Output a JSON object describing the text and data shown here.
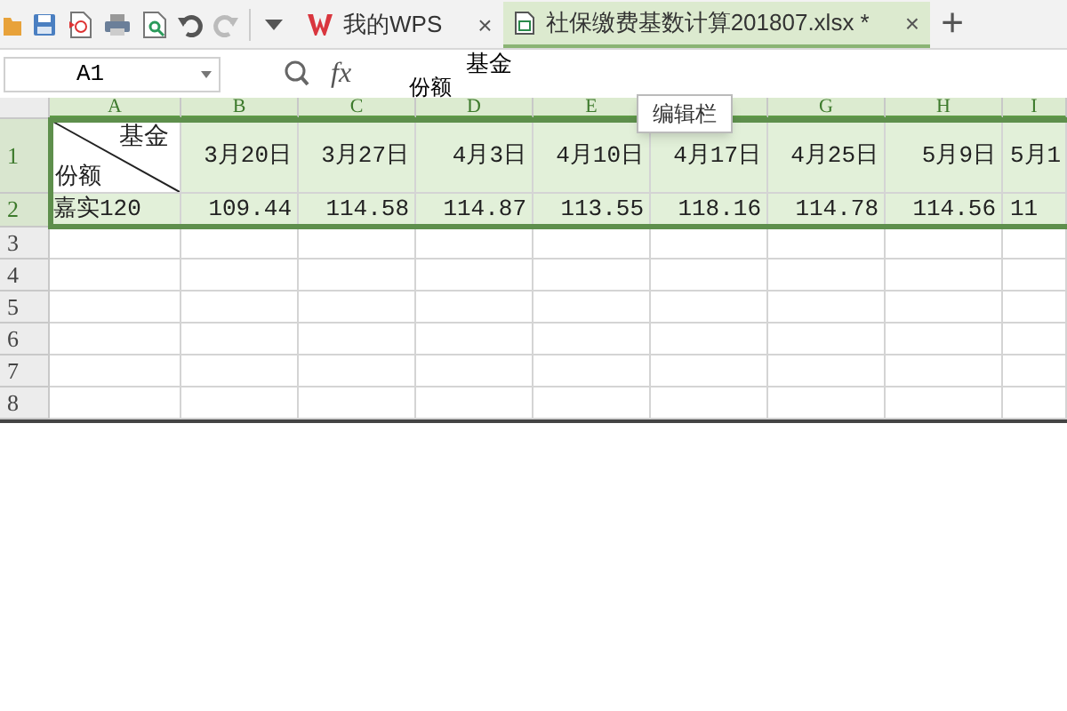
{
  "tabs": [
    {
      "label": "我的WPS",
      "close": "×",
      "selected": false
    },
    {
      "label": "社保缴费基数计算201807.xlsx *",
      "close": "×",
      "selected": true
    }
  ],
  "new_tab": "+",
  "name_box": {
    "value": "A1"
  },
  "formula_bar": {
    "fx": "fx",
    "lines": [
      "基金",
      "份额"
    ]
  },
  "tooltip": "编辑栏",
  "columns": [
    {
      "letter": "A",
      "selected": true
    },
    {
      "letter": "B",
      "selected": true
    },
    {
      "letter": "C",
      "selected": true
    },
    {
      "letter": "D",
      "selected": true
    },
    {
      "letter": "E",
      "selected": true
    },
    {
      "selected": true
    },
    {
      "letter": "G",
      "selected": true
    },
    {
      "letter": "H",
      "selected": true
    },
    {
      "letter": "I",
      "selected": true
    }
  ],
  "rows": [
    {
      "number": "1",
      "selected": true,
      "cells": [
        {
          "kind": "diagonal",
          "top": "基金",
          "bottom": "份额",
          "active": true
        },
        {
          "kind": "text",
          "text": "3月20日"
        },
        {
          "kind": "text",
          "text": "3月27日"
        },
        {
          "kind": "text",
          "text": "4月3日"
        },
        {
          "kind": "text",
          "text": "4月10日"
        },
        {
          "kind": "text",
          "text": "4月17日"
        },
        {
          "kind": "text",
          "text": "4月25日"
        },
        {
          "kind": "text",
          "text": "5月9日"
        },
        {
          "kind": "text",
          "text": "5月1"
        }
      ]
    },
    {
      "number": "2",
      "selected": true,
      "cells": [
        {
          "kind": "text",
          "text": "嘉实120"
        },
        {
          "kind": "text",
          "text": "109.44"
        },
        {
          "kind": "text",
          "text": "114.58"
        },
        {
          "kind": "text",
          "text": "114.87"
        },
        {
          "kind": "text",
          "text": "113.55"
        },
        {
          "kind": "text",
          "text": "118.16"
        },
        {
          "kind": "text",
          "text": "114.78"
        },
        {
          "kind": "text",
          "text": "114.56"
        },
        {
          "kind": "text",
          "text": "11"
        }
      ]
    },
    {
      "number": "3",
      "selected": false
    },
    {
      "number": "4",
      "selected": false
    },
    {
      "number": "5",
      "selected": false
    },
    {
      "number": "6",
      "selected": false
    },
    {
      "number": "7",
      "selected": false
    },
    {
      "number": "8",
      "selected": false
    }
  ]
}
